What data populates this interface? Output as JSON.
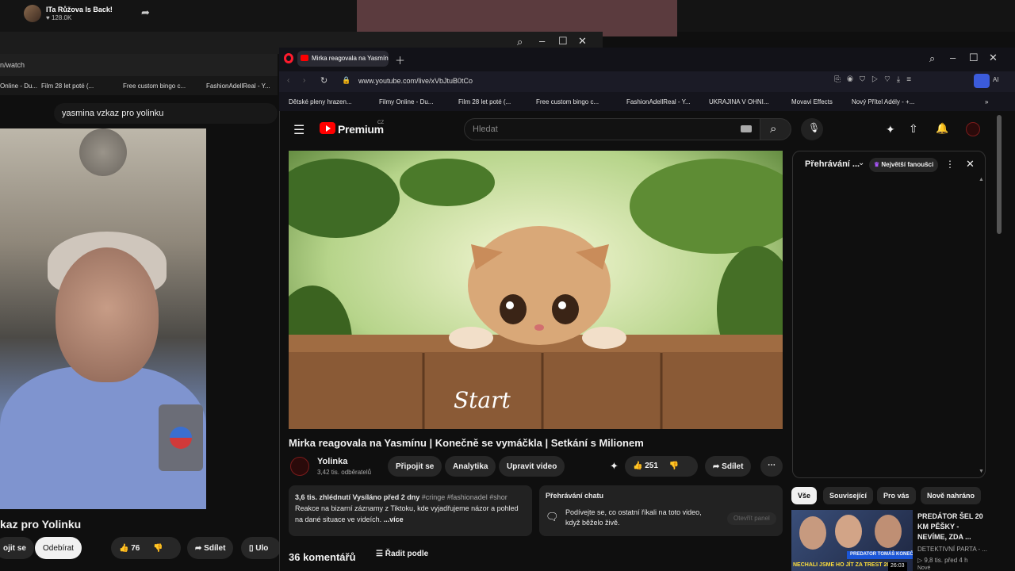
{
  "background_stream": {
    "title": "ITa Růžova Is Back!",
    "likes": "128.0K"
  },
  "bg_window": {
    "url": "n/watch",
    "bookmarks": [
      "Online - Du...",
      "Film 28 let poté (...",
      "Free custom bingo c...",
      "FashionAdellReal - Y..."
    ],
    "search_query": "yasmina vzkaz pro yolinku",
    "video_title": "kaz pro Yolinku",
    "subscribe_partial": "ojit se",
    "unsubscribe": "Odebírat",
    "likes": "76",
    "share": "Sdílet",
    "save_partial": "Ulo"
  },
  "browser": {
    "tab_title": "Mirka reagovala na Yasmín",
    "url": "www.youtube.com/live/xVbJtuB0tCo",
    "ai_label": "AI",
    "bookmarks": [
      "Dětské pleny hrazen...",
      "Filmy Online - Du...",
      "Film 28 let poté (...",
      "Free custom bingo c...",
      "FashionAdellReal - Y...",
      "UKRAJINA V OHNI...",
      "Movavi Effects",
      "Nový Přítel Adély - +..."
    ]
  },
  "youtube": {
    "logo_text": "Premium",
    "logo_region": "CZ",
    "search_placeholder": "Hledat",
    "video_title": "Mirka reagovala na Yasmínu | Konečně se vymáčkla | Setkání s Milionem",
    "overlay_text": "Start",
    "channel_name": "Yolinka",
    "subscribers": "3,42 tis. odběratelů",
    "join_button": "Připojit se",
    "analytics_button": "Analytika",
    "edit_button": "Upravit video",
    "likes": "251",
    "share": "Sdílet",
    "description_stats": "3,6 tis. zhlédnutí  Vysíláno před 2 dny",
    "description_tags": "#cringe #fashionadel #shor",
    "description_text": "Reakce  na bizarní záznamy z Tiktoku, kde vyjadřujeme názor a pohled na dané situace ve videích.",
    "description_more": "...více",
    "chat_replay_title": "Přehrávání chatu",
    "chat_replay_text": "Podívejte se, co ostatní říkali na toto video, když běželo živě.",
    "chat_replay_button": "Otevřít panel",
    "comments_count": "36 komentářů",
    "sort_label": "Řadit podle",
    "chat_panel_title": "Přehrávání ...",
    "chat_panel_badge": "Největší fanoušci",
    "chips": [
      "Vše",
      "Související",
      "Pro vás",
      "Nově nahráno"
    ],
    "recommendation": {
      "title": "PREDÁTOR ŠEL 20 KM PĚŠKY - NEVÍME, ZDA ...",
      "channel": "DETEKTIVNÍ PARTA - ...",
      "meta": "9,8 tis.  před 4 h",
      "badge": "Nové",
      "thumb_text": "PREDATOR TOMÁŠ KONEČNÝ",
      "thumb_bottom": "NECHALI JSME HO JÍT ZA TREST 20 KM",
      "duration": "26:03"
    }
  },
  "icons": [
    "share-arrow-icon",
    "search-icon",
    "minimize-icon",
    "maximize-icon",
    "close-icon",
    "reload-icon",
    "lock-icon",
    "menu-icon",
    "mic-icon",
    "create-icon",
    "upload-icon",
    "bell-icon",
    "like-icon",
    "dislike-icon",
    "more-icon",
    "sort-icon",
    "chat-icon",
    "chevron-down-icon",
    "crown-icon"
  ],
  "colors": {
    "youtube_red": "#ff0000",
    "opera_red": "#ff1b2d",
    "background": "#0f0f0f",
    "chip_active": "#f1f1f1"
  }
}
